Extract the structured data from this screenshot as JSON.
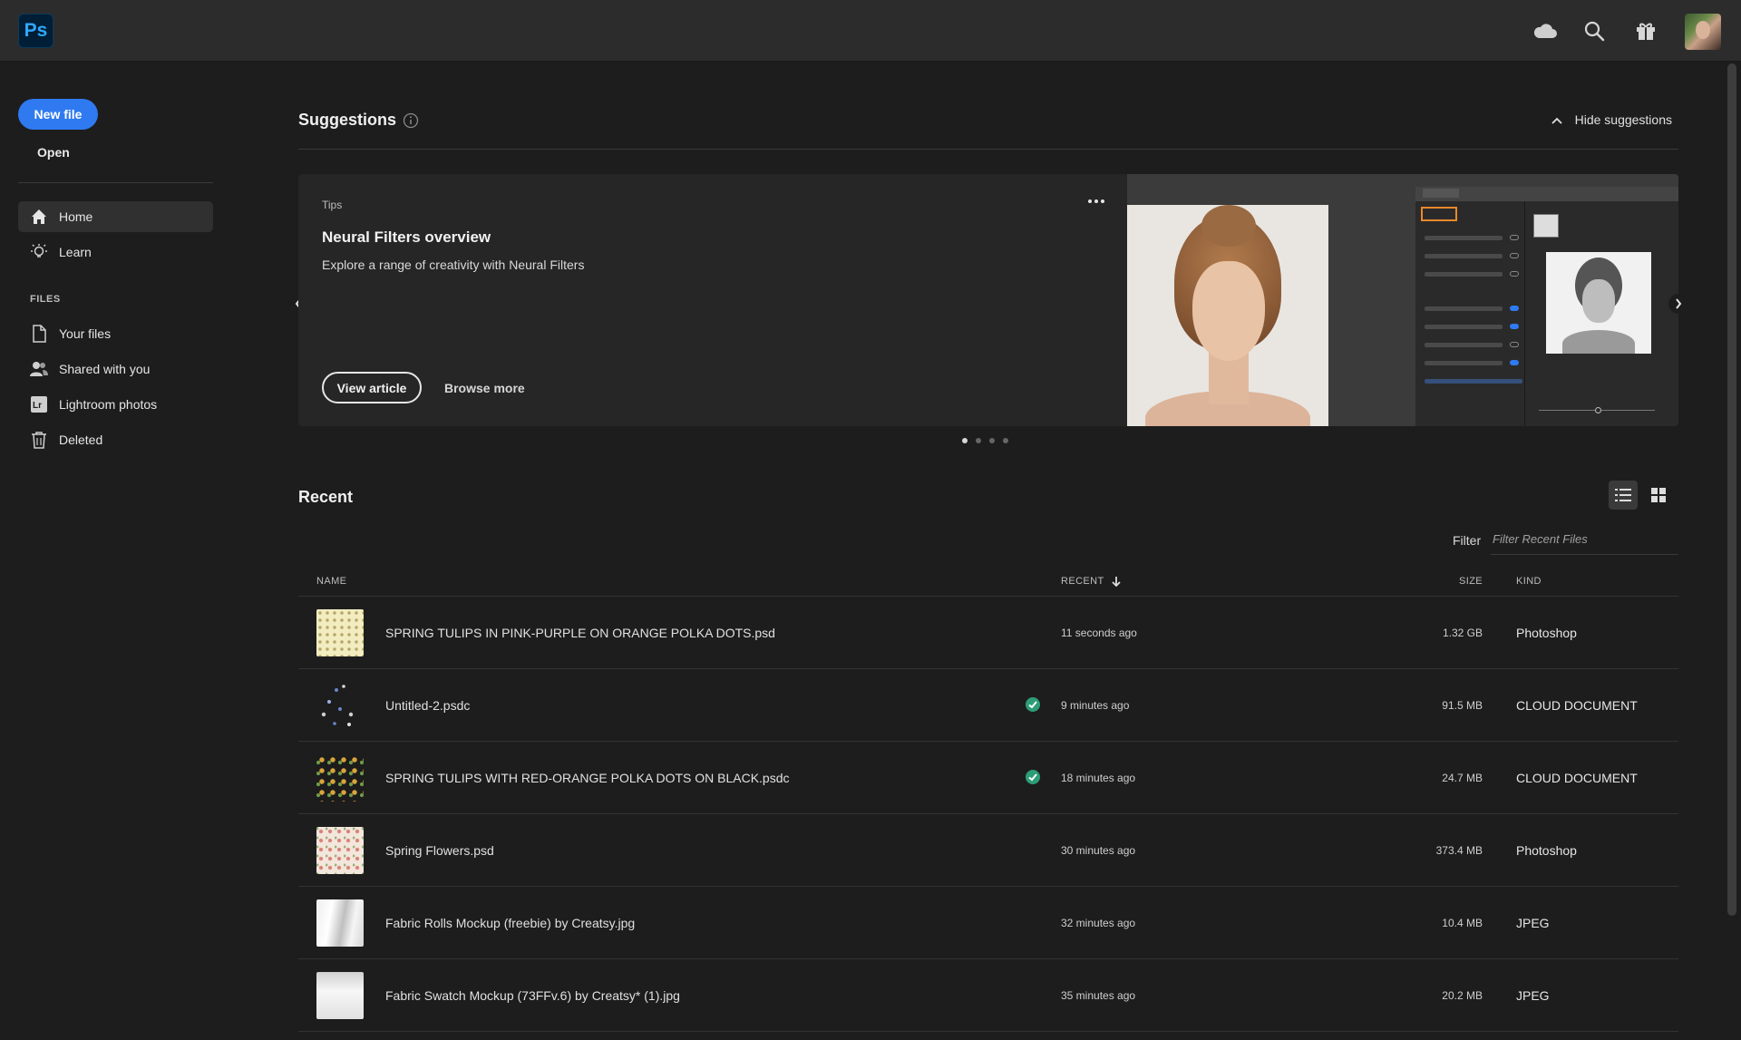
{
  "app": {
    "logo_text": "Ps"
  },
  "topbar": {
    "icons": [
      "cloud-icon",
      "search-icon",
      "gift-icon"
    ]
  },
  "sidebar": {
    "new_file_label": "New file",
    "open_label": "Open",
    "nav": [
      {
        "label": "Home",
        "icon": "home-icon",
        "active": true
      },
      {
        "label": "Learn",
        "icon": "lightbulb-icon",
        "active": false
      }
    ],
    "files_section_label": "FILES",
    "files": [
      {
        "label": "Your files",
        "icon": "file-icon"
      },
      {
        "label": "Shared with you",
        "icon": "shared-users-icon"
      },
      {
        "label": "Lightroom photos",
        "icon": "lightroom-icon"
      },
      {
        "label": "Deleted",
        "icon": "trash-icon"
      }
    ]
  },
  "suggestions": {
    "title": "Suggestions",
    "hide_label": "Hide suggestions",
    "card": {
      "tag": "Tips",
      "title": "Neural Filters overview",
      "description": "Explore a range of creativity with Neural Filters",
      "primary_action": "View article",
      "secondary_action": "Browse more"
    },
    "carousel_pages": 4,
    "carousel_active_page": 1
  },
  "recent": {
    "title": "Recent",
    "view_mode": "list",
    "filter_label": "Filter",
    "filter_placeholder": "Filter Recent Files",
    "columns": {
      "name": "NAME",
      "recent": "RECENT",
      "size": "SIZE",
      "kind": "KIND"
    },
    "rows": [
      {
        "name": "SPRING TULIPS IN PINK-PURPLE ON ORANGE POLKA DOTS.psd",
        "recent": "11 seconds ago",
        "size": "1.32 GB",
        "kind": "Photoshop",
        "synced": false,
        "thumb": "t-dots1"
      },
      {
        "name": "Untitled-2.psdc",
        "recent": "9 minutes ago",
        "size": "91.5 MB",
        "kind": "CLOUD DOCUMENT",
        "synced": true,
        "thumb": "t-scatter"
      },
      {
        "name": "SPRING TULIPS WITH RED-ORANGE POLKA DOTS ON BLACK.psdc",
        "recent": "18 minutes ago",
        "size": "24.7 MB",
        "kind": "CLOUD DOCUMENT",
        "synced": true,
        "thumb": "t-dark"
      },
      {
        "name": "Spring Flowers.psd",
        "recent": "30 minutes ago",
        "size": "373.4 MB",
        "kind": "Photoshop",
        "synced": false,
        "thumb": "t-floral"
      },
      {
        "name": "Fabric Rolls Mockup (freebie) by Creatsy.jpg",
        "recent": "32 minutes ago",
        "size": "10.4 MB",
        "kind": "JPEG",
        "synced": false,
        "thumb": "t-fabric"
      },
      {
        "name": "Fabric Swatch Mockup (73FFv.6) by Creatsy* (1).jpg",
        "recent": "35 minutes ago",
        "size": "20.2 MB",
        "kind": "JPEG",
        "synced": false,
        "thumb": "t-swatch"
      }
    ]
  },
  "colors": {
    "accent": "#2f7af0",
    "background": "#1d1d1d",
    "topbar": "#2c2c2c",
    "sync_ok": "#2d9d78"
  }
}
